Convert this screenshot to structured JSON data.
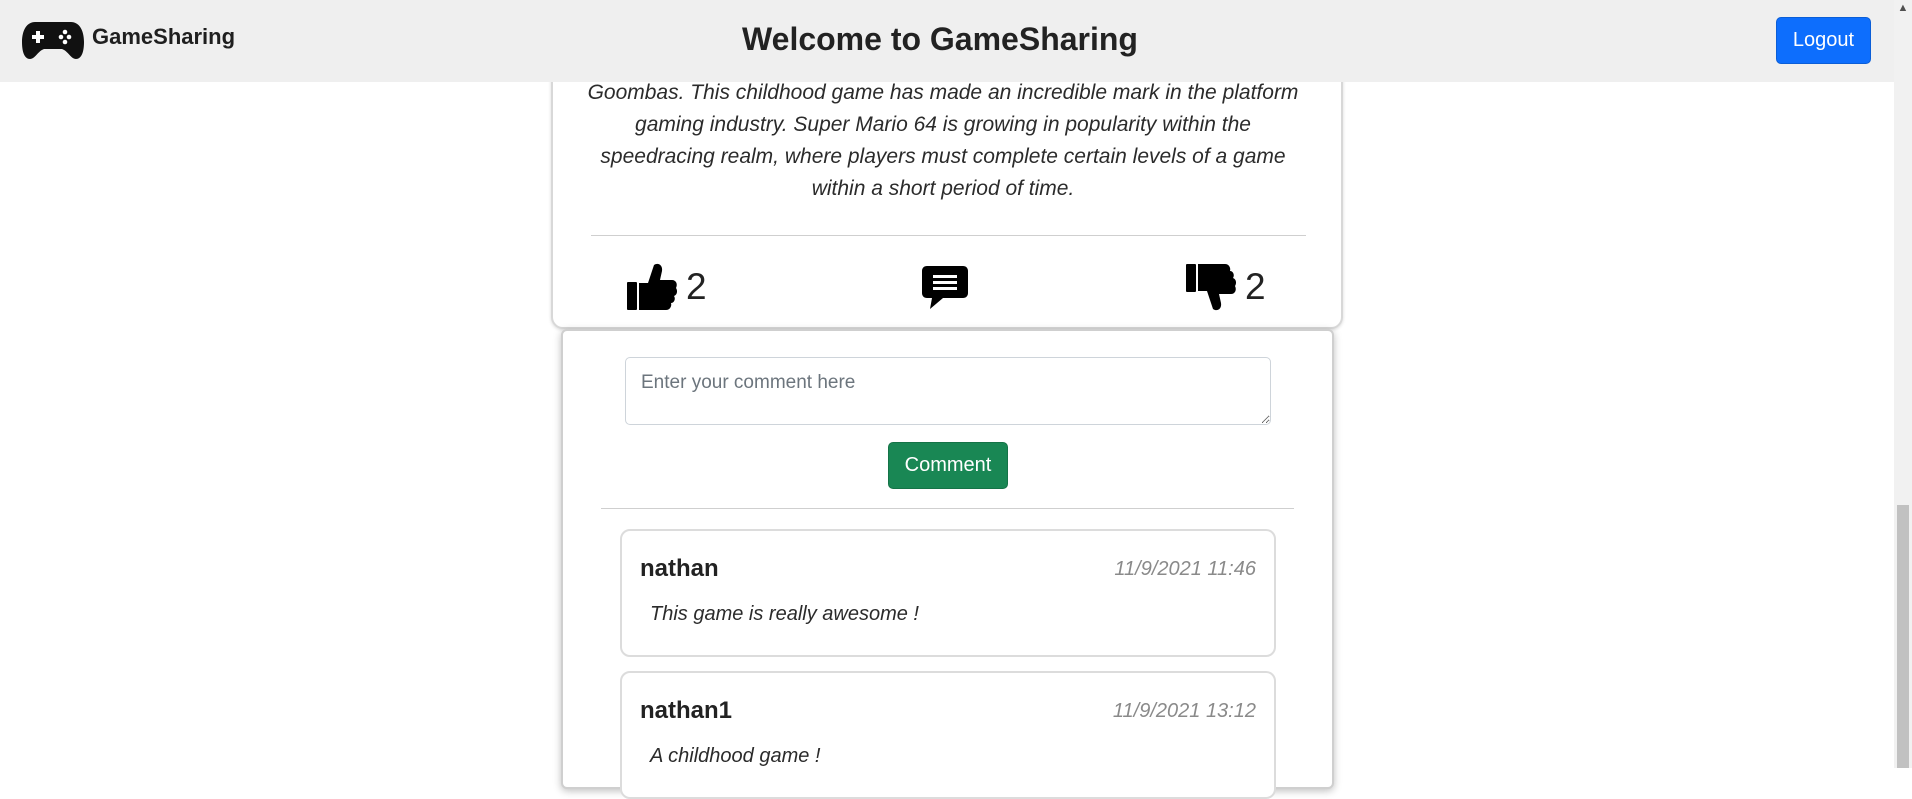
{
  "navbar": {
    "brand_name": "GameSharing",
    "brand_icon": "gamepad-icon",
    "title": "Welcome to GameSharing",
    "logout_label": "Logout",
    "accent_color": "#0d6efd"
  },
  "post": {
    "description": "Goombas. This childhood game has made an incredible mark in the platform gaming industry. Super Mario 64 is growing in popularity within the speedracing realm, where players must complete certain levels of a game within a short period of time.",
    "likes": "2",
    "dislikes": "2",
    "like_icon": "thumbs-up-icon",
    "comment_icon": "comment-icon",
    "dislike_icon": "thumbs-down-icon"
  },
  "comment_form": {
    "placeholder": "Enter your comment here",
    "value": "",
    "submit_label": "Comment",
    "submit_color": "#198754"
  },
  "comments": [
    {
      "author": "nathan",
      "timestamp": "11/9/2021 11:46",
      "text": "This game is really awesome !"
    },
    {
      "author": "nathan1",
      "timestamp": "11/9/2021 13:12",
      "text": "A childhood game !"
    }
  ]
}
